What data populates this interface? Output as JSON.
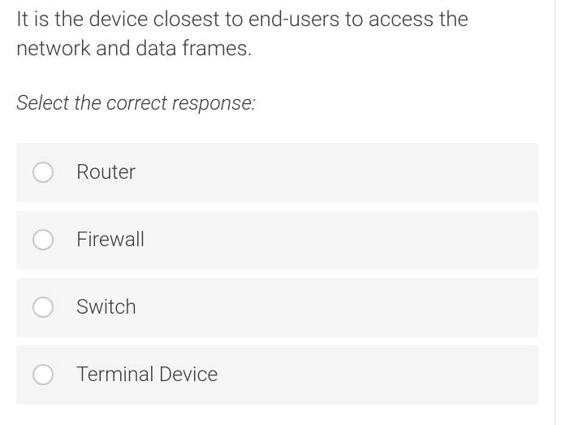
{
  "question": {
    "text": "It is the device closest to end-users to access the network and data frames.",
    "instruction": "Select the correct response:"
  },
  "options": [
    {
      "label": "Router"
    },
    {
      "label": "Firewall"
    },
    {
      "label": "Switch"
    },
    {
      "label": "Terminal Device"
    }
  ]
}
